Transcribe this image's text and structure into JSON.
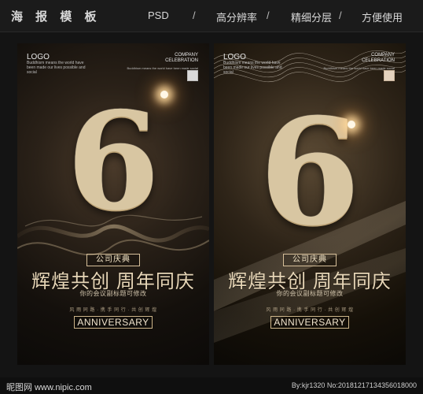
{
  "topbar": {
    "brand": "海 报 模 板",
    "items": [
      "PSD",
      "高分辨率",
      "精细分层",
      "方便使用"
    ],
    "separator": "/"
  },
  "posters": [
    {
      "logo": "LOGO",
      "logo_sub": "Buddhism means the world have been made our lives possible and social",
      "company": "COMPANY\nCELEBRATION",
      "company_sub": "Buddhism means the world have been made social",
      "number": "6",
      "tag": "公司庆典",
      "headline": "辉煌共创 周年同庆",
      "sub": "你的会议副标题可修改",
      "tiny": "风 雨 同 路 · 携 手 同 行 · 共 创 辉 煌",
      "anniversary": "ANNIVERSARY"
    },
    {
      "logo": "LOGO",
      "logo_sub": "Buddhism means the world have been made our lives possible and social",
      "company": "COMPANY\nCELEBRATION",
      "company_sub": "Buddhism means the world have been made social",
      "number": "6",
      "tag": "公司庆典",
      "headline": "辉煌共创 周年同庆",
      "sub": "你的会议副标题可修改",
      "tiny": "风 雨 同 路 · 携 手 同 行 · 共 创 辉 煌",
      "anniversary": "ANNIVERSARY"
    }
  ],
  "footer": {
    "site": "昵图网 www.nipic.com",
    "meta": "By:kjr1320 No:20181217134356018000"
  },
  "colors": {
    "gold": "#d8c6a2",
    "dark": "#141414"
  }
}
